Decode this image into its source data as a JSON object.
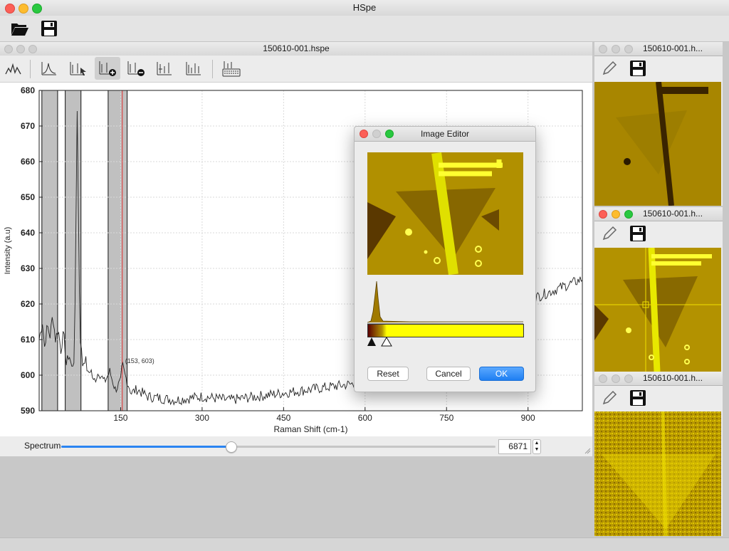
{
  "app": {
    "title": "HSpe"
  },
  "main_toolbar": {
    "open_icon": "folder-open-icon",
    "save_icon": "floppy-save-icon"
  },
  "spectrum_window": {
    "title": "150610-001.hspe",
    "tools": [
      "spectrum-view-icon",
      "peak-fit-icon",
      "peak-select-icon",
      "add-region-icon",
      "remove-region-icon",
      "peak-list-icon",
      "multi-peak-icon",
      "keyboard-icon"
    ],
    "slider": {
      "label": "Spectrum",
      "value": "6871",
      "position_fraction": 0.39
    }
  },
  "chart_data": {
    "type": "line",
    "xlabel": "Raman Shift (cm-1)",
    "ylabel": "Intensity (a.u)",
    "xlim": [
      0,
      1000
    ],
    "ylim": [
      590,
      680
    ],
    "xticks": [
      150,
      300,
      450,
      600,
      750,
      900
    ],
    "yticks": [
      590,
      600,
      610,
      620,
      630,
      640,
      650,
      660,
      670,
      680
    ],
    "grid": true,
    "cursor_label": "(153, 603)",
    "cursor_x": 153,
    "selected_regions": [
      [
        5,
        34
      ],
      [
        48,
        77
      ],
      [
        127,
        162
      ]
    ],
    "series": [
      {
        "x": [
          0,
          6,
          10,
          15,
          20,
          25,
          30,
          35,
          40,
          45,
          50,
          55,
          60,
          65,
          70,
          75,
          80,
          85,
          90,
          95,
          100,
          110,
          120,
          130,
          140,
          150,
          153,
          158,
          165,
          170,
          180,
          200,
          250,
          300,
          350,
          400,
          450,
          500,
          550,
          600,
          650,
          700,
          750,
          800,
          850,
          900,
          950,
          1000
        ],
        "y": [
          610,
          615,
          608,
          614,
          611,
          617,
          610,
          613,
          607,
          612,
          603,
          606,
          602,
          605,
          675,
          612,
          603,
          605,
          600,
          602,
          598,
          601,
          598,
          601,
          596,
          598,
          603,
          600,
          597,
          595,
          596,
          594,
          593,
          594,
          593,
          594,
          595,
          596,
          597,
          598,
          600,
          604,
          610,
          615,
          619,
          621,
          624,
          627
        ]
      }
    ]
  },
  "image_editor": {
    "title": "Image Editor",
    "reset": "Reset",
    "cancel": "Cancel",
    "ok": "OK"
  },
  "side_windows": [
    {
      "title": "150610-001.h...",
      "edit_icon": "pencil-icon",
      "save_icon": "floppy-save-icon"
    },
    {
      "title": "150610-001.h...",
      "edit_icon": "pencil-icon",
      "save_icon": "floppy-save-icon"
    },
    {
      "title": "150610-001.h...",
      "edit_icon": "pencil-icon",
      "save_icon": "floppy-save-icon"
    }
  ],
  "colors": {
    "accent": "#2a84f2",
    "gold": "#b29200",
    "yellow": "#ffff00"
  }
}
